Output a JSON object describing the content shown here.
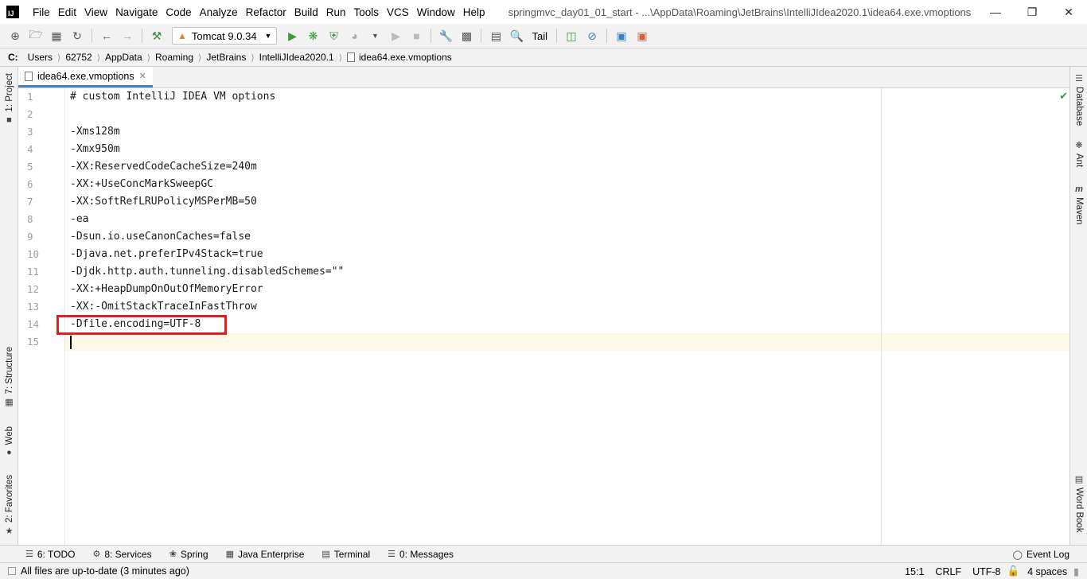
{
  "app": {
    "logo_text": "IJ"
  },
  "menu": [
    "File",
    "Edit",
    "View",
    "Navigate",
    "Code",
    "Analyze",
    "Refactor",
    "Build",
    "Run",
    "Tools",
    "VCS",
    "Window",
    "Help"
  ],
  "window_title": "springmvc_day01_01_start - ...\\AppData\\Roaming\\JetBrains\\IntelliJIdea2020.1\\idea64.exe.vmoptions",
  "toolbar": {
    "run_config": "Tomcat 9.0.34",
    "tail": "Tail"
  },
  "breadcrumb": [
    "C:",
    "Users",
    "62752",
    "AppData",
    "Roaming",
    "JetBrains",
    "IntelliJIdea2020.1",
    "idea64.exe.vmoptions"
  ],
  "left_tools": [
    "1: Project",
    "7: Structure",
    "Web",
    "2: Favorites"
  ],
  "right_tools": [
    "Database",
    "Ant",
    "Maven",
    "Word Book"
  ],
  "editor": {
    "tab": "idea64.exe.vmoptions",
    "lines": [
      "# custom IntelliJ IDEA VM options",
      "",
      "-Xms128m",
      "-Xmx950m",
      "-XX:ReservedCodeCacheSize=240m",
      "-XX:+UseConcMarkSweepGC",
      "-XX:SoftRefLRUPolicyMSPerMB=50",
      "-ea",
      "-Dsun.io.useCanonCaches=false",
      "-Djava.net.preferIPv4Stack=true",
      "-Djdk.http.auth.tunneling.disabledSchemes=\"\"",
      "-XX:+HeapDumpOnOutOfMemoryError",
      "-XX:-OmitStackTraceInFastThrow",
      "-Dfile.encoding=UTF-8",
      ""
    ],
    "line_numbers": [
      "1",
      "2",
      "3",
      "4",
      "5",
      "6",
      "7",
      "8",
      "9",
      "10",
      "11",
      "12",
      "13",
      "14",
      "15"
    ]
  },
  "bottom_tools": [
    "6: TODO",
    "8: Services",
    "Spring",
    "Java Enterprise",
    "Terminal",
    "0: Messages"
  ],
  "event_log": "Event Log",
  "status": {
    "message": "All files are up-to-date (3 minutes ago)",
    "position": "15:1",
    "line_sep": "CRLF",
    "encoding": "UTF-8",
    "indent": "4 spaces"
  }
}
